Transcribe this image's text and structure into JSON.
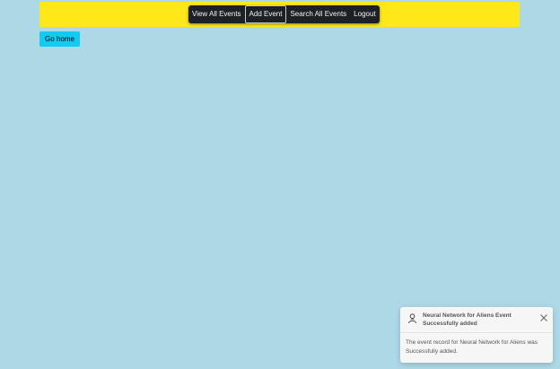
{
  "nav": {
    "items": [
      {
        "label": "View All Events"
      },
      {
        "label": "Add Event"
      },
      {
        "label": "Search All Events"
      },
      {
        "label": "Logout"
      }
    ]
  },
  "home_button": {
    "label": "Go home"
  },
  "toast": {
    "title": "Neural Network for Aliens Event Successfully added",
    "body": "The event record for Neural Network for Aliens was Successfully added.",
    "icon": "person-icon"
  },
  "colors": {
    "background": "#add8e6",
    "top_bar": "#ffe81a",
    "nav_bg": "#1d2125",
    "home_button": "#13caf0"
  }
}
